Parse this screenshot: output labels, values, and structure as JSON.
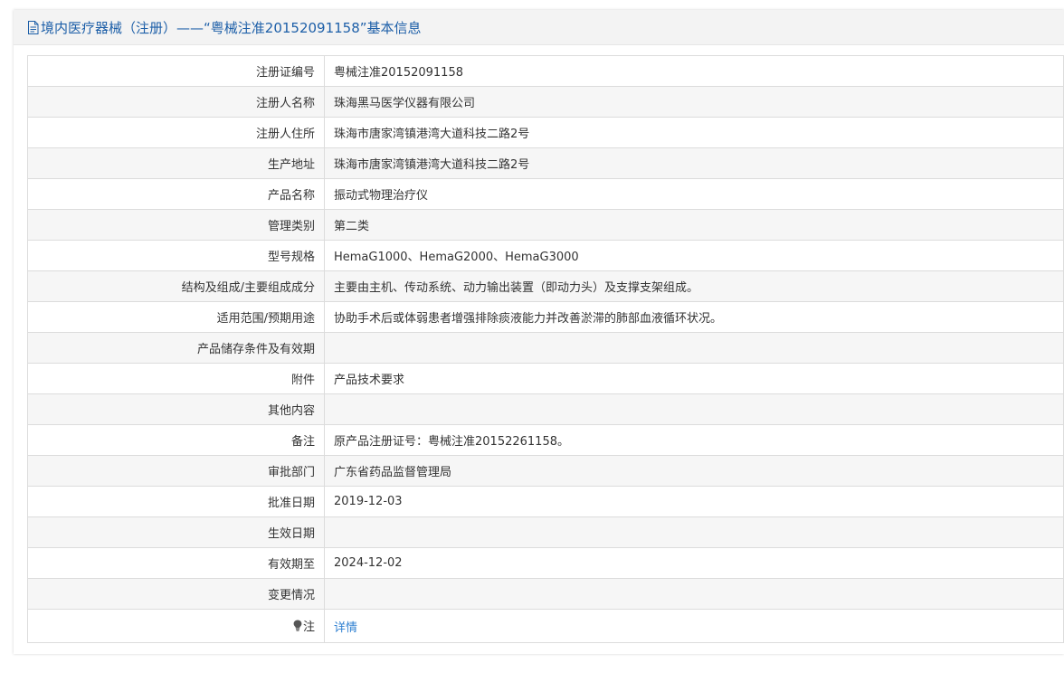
{
  "header": {
    "title": "境内医疗器械（注册）——“粤械注准20152091158”基本信息",
    "icon": "document-icon",
    "color": "#1d5fa8"
  },
  "rows": [
    {
      "label": "注册证编号",
      "value": "粤械注准20152091158"
    },
    {
      "label": "注册人名称",
      "value": "珠海黑马医学仪器有限公司"
    },
    {
      "label": "注册人住所",
      "value": "珠海市唐家湾镇港湾大道科技二路2号"
    },
    {
      "label": "生产地址",
      "value": "珠海市唐家湾镇港湾大道科技二路2号"
    },
    {
      "label": "产品名称",
      "value": "振动式物理治疗仪"
    },
    {
      "label": "管理类别",
      "value": "第二类"
    },
    {
      "label": "型号规格",
      "value": "HemaG1000、HemaG2000、HemaG3000"
    },
    {
      "label": "结构及组成/主要组成成分",
      "value": "主要由主机、传动系统、动力输出装置（即动力头）及支撑支架组成。"
    },
    {
      "label": "适用范围/预期用途",
      "value": "协助手术后或体弱患者增强排除痰液能力并改善淤滞的肺部血液循环状况。"
    },
    {
      "label": "产品储存条件及有效期",
      "value": ""
    },
    {
      "label": "附件",
      "value": "产品技术要求"
    },
    {
      "label": "其他内容",
      "value": ""
    },
    {
      "label": "备注",
      "value": "原产品注册证号：粤械注准20152261158。"
    },
    {
      "label": "审批部门",
      "value": "广东省药品监督管理局"
    },
    {
      "label": "批准日期",
      "value": "2019-12-03"
    },
    {
      "label": "生效日期",
      "value": ""
    },
    {
      "label": "有效期至",
      "value": "2024-12-02"
    },
    {
      "label": "变更情况",
      "value": ""
    }
  ],
  "note": {
    "label": "注",
    "icon": "lightbulb-icon",
    "link_text": "详情",
    "link_color": "#2f80d1"
  }
}
